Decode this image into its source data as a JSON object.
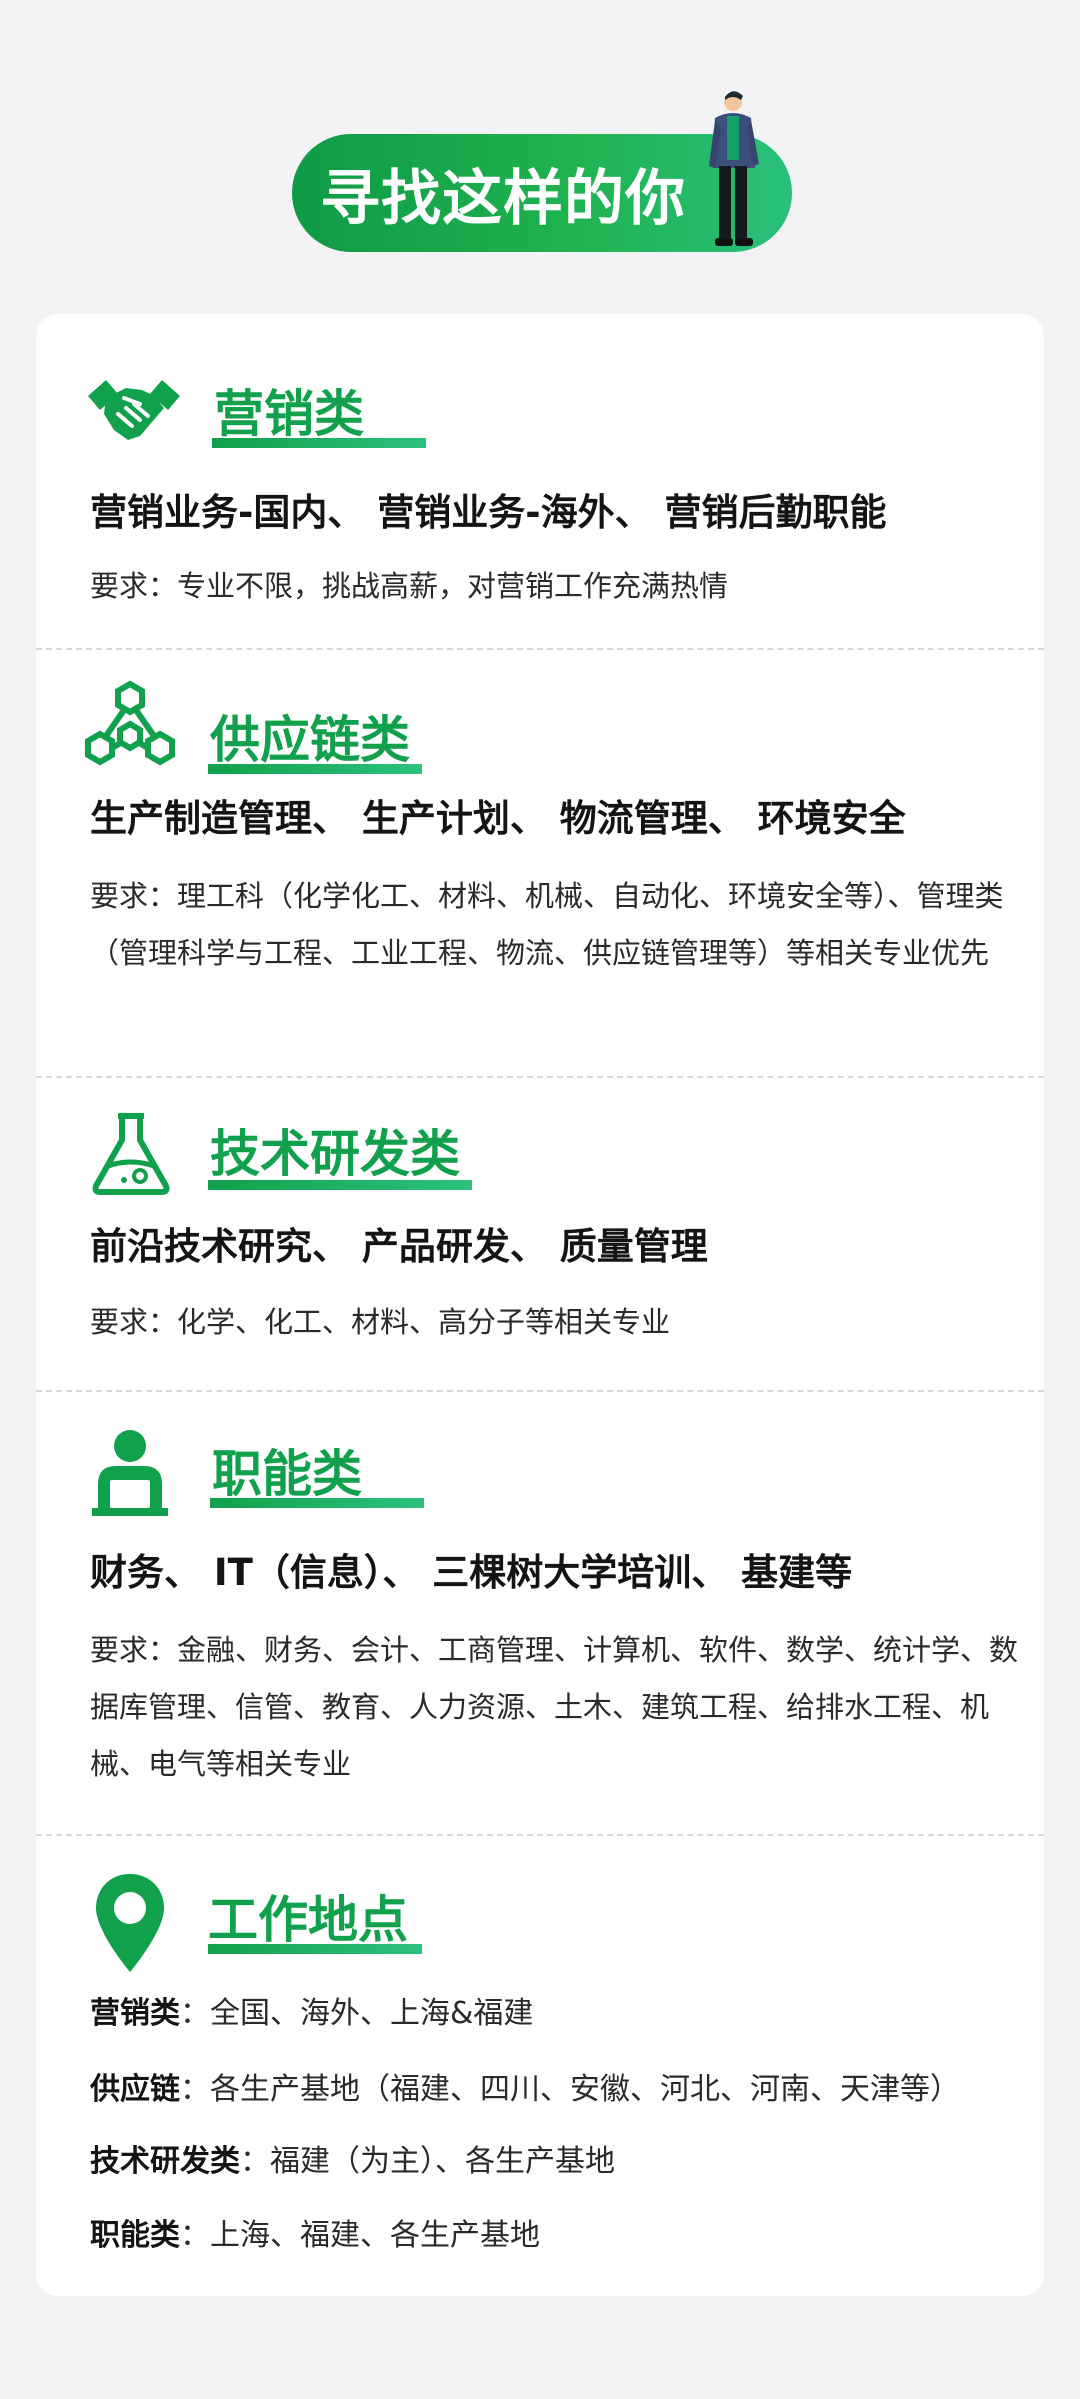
{
  "banner": {
    "title": "寻找这样的你"
  },
  "sections": [
    {
      "title": "营销类",
      "icon": "handshake-icon",
      "roles": "营销业务-国内、 营销业务-海外、 营销后勤职能",
      "requirement": "要求：专业不限，挑战高薪，对营销工作充满热情"
    },
    {
      "title": "供应链类",
      "icon": "hexagon-network-icon",
      "roles": "生产制造管理、 生产计划、 物流管理、 环境安全",
      "requirement": "要求：理工科（化学化工、材料、机械、自动化、环境安全等）、管理类（管理科学与工程、工业工程、物流、供应链管理等）等相关专业优先"
    },
    {
      "title": "技术研发类",
      "icon": "flask-icon",
      "roles": "前沿技术研究、 产品研发、 质量管理",
      "requirement": "要求：化学、化工、材料、高分子等相关专业"
    },
    {
      "title": "职能类",
      "icon": "office-worker-icon",
      "roles": "财务、 IT（信息）、 三棵树大学培训、 基建等",
      "requirement": "要求：金融、财务、会计、工商管理、计算机、软件、数学、统计学、数据库管理、信管、教育、人力资源、土木、建筑工程、给排水工程、机械、电气等相关专业"
    }
  ],
  "location": {
    "title": "工作地点",
    "icon": "map-pin-icon",
    "rows": [
      {
        "label": "营销类",
        "value": "：全国、海外、上海&福建"
      },
      {
        "label": "供应链",
        "value": "：各生产基地（福建、四川、安徽、河北、河南、天津等）"
      },
      {
        "label": "技术研发类",
        "value": "：福建（为主）、各生产基地"
      },
      {
        "label": "职能类",
        "value": "：上海、福建、各生产基地"
      }
    ]
  },
  "colors": {
    "accent": "#11a04b",
    "accent_light": "#2cc27e",
    "background": "#f3f3f5",
    "card": "#ffffff"
  }
}
